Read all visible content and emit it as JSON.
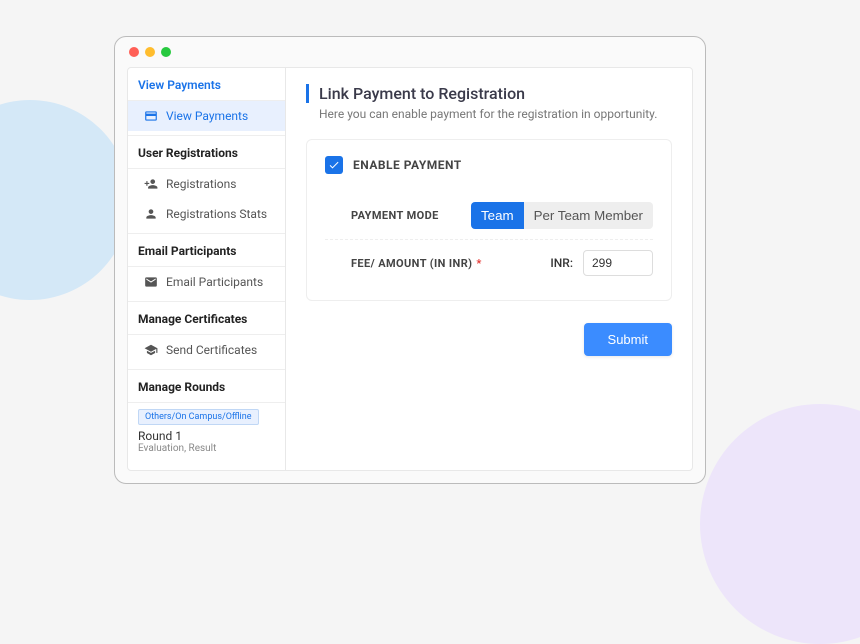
{
  "sidebar": {
    "section1": {
      "header": "View Payments",
      "item": "View Payments"
    },
    "section2": {
      "header": "User Registrations",
      "itemA": "Registrations",
      "itemB": "Registrations Stats"
    },
    "section3": {
      "header": "Email Participants",
      "item": "Email Participants"
    },
    "section4": {
      "header": "Manage Certificates",
      "item": "Send Certificates"
    },
    "section5": {
      "header": "Manage Rounds",
      "tag": "Others/On Campus/Offline",
      "roundName": "Round 1",
      "roundSub": "Evaluation, Result"
    }
  },
  "main": {
    "title": "Link Payment to Registration",
    "subtitle": "Here you can enable payment for the registration in opportunity.",
    "enableLabel": "ENABLE PAYMENT",
    "paymentModeLabel": "PAYMENT MODE",
    "toggleTeam": "Team",
    "togglePerMember": "Per Team Member",
    "feeLabel": "FEE/ AMOUNT (IN INR)",
    "inrLabel": "INR:",
    "feeValue": "299",
    "submit": "Submit"
  }
}
